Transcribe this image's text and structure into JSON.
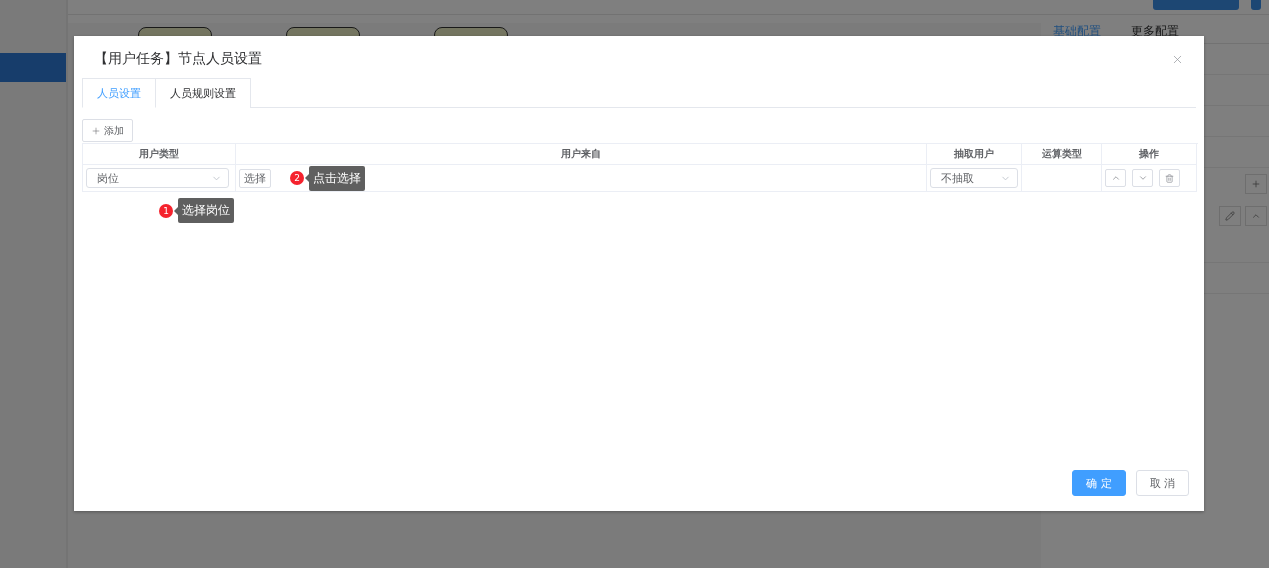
{
  "background": {
    "panel_tabs": [
      {
        "label": "基础配置",
        "selected": true
      },
      {
        "label": "更多配置",
        "selected": false
      }
    ]
  },
  "dialog": {
    "title": "【用户任务】节点人员设置",
    "tabs": [
      {
        "label": "人员设置",
        "selected": true
      },
      {
        "label": "人员规则设置",
        "selected": false
      }
    ],
    "add_button": "添加",
    "table": {
      "columns": [
        "用户类型",
        "用户来自",
        "抽取用户",
        "运算类型",
        "操作"
      ],
      "rows": [
        {
          "user_type": "岗位",
          "choose_button": "选择",
          "extract": "不抽取"
        }
      ]
    },
    "hints": [
      {
        "number": "1",
        "text": "选择岗位"
      },
      {
        "number": "2",
        "text": "点击选择"
      }
    ],
    "buttons": [
      {
        "label": "确 定",
        "kind": "primary"
      },
      {
        "label": "取 消",
        "kind": "default"
      }
    ]
  }
}
